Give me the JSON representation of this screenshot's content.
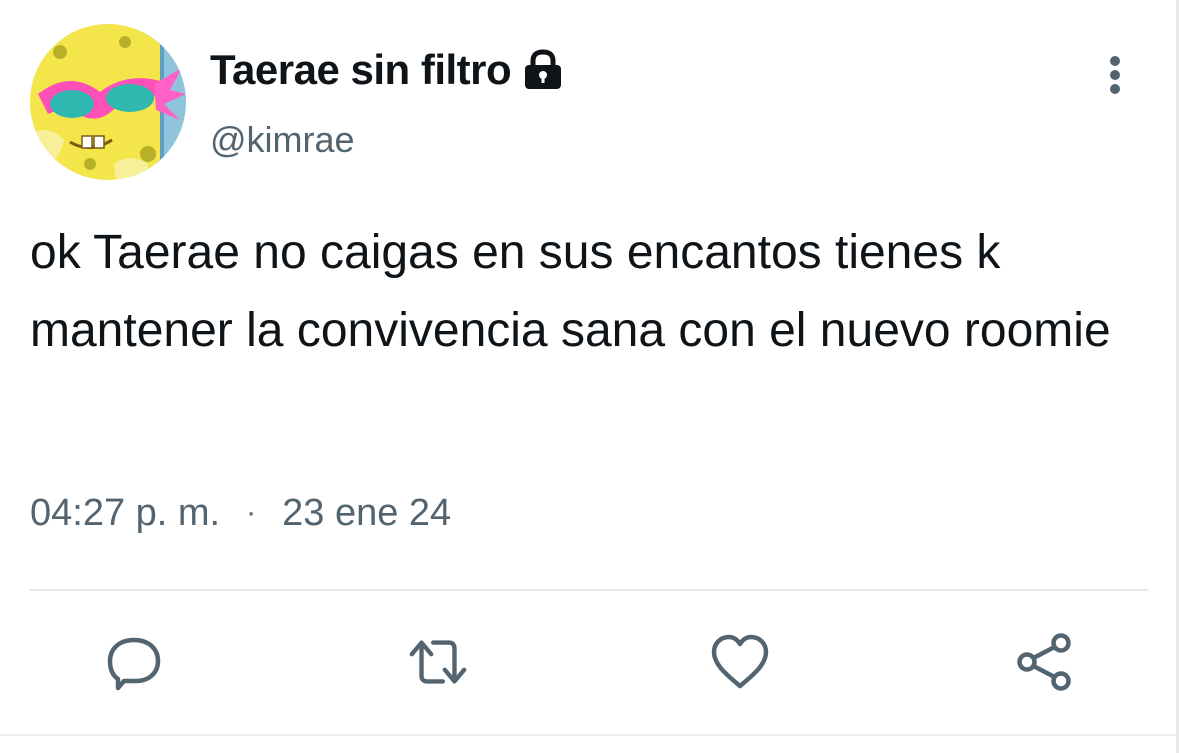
{
  "user": {
    "display_name": "Taerae sin filtro",
    "handle": "@kimrae",
    "verified_lock": "lock-icon"
  },
  "tweet": {
    "text": "ok Taerae no caigas en sus encantos tienes k mantener la convivencia sana con el nuevo roomie",
    "time": "04:27 p. m.",
    "separator": "·",
    "date": "23 ene 24"
  },
  "actions": {
    "reply": "reply-icon",
    "retweet": "retweet-icon",
    "like": "heart-icon",
    "share": "share-icon"
  },
  "colors": {
    "text_primary": "#0f1419",
    "text_secondary": "#536471",
    "icon": "#536471"
  }
}
